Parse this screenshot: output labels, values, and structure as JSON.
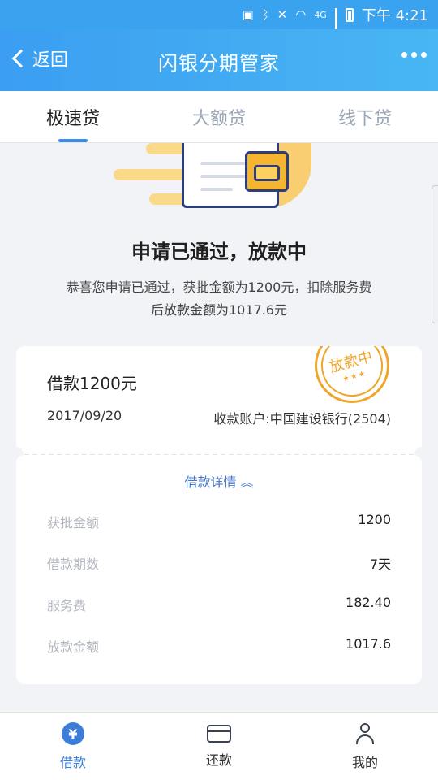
{
  "status_bar": {
    "network": "4G",
    "time": "下午 4:21"
  },
  "header": {
    "back_label": "返回",
    "title": "闪银分期管家"
  },
  "tabs": [
    {
      "label": "极速贷",
      "active": true
    },
    {
      "label": "大额贷",
      "active": false
    },
    {
      "label": "线下贷",
      "active": false
    }
  ],
  "result": {
    "title": "申请已通过，放款中",
    "desc_line1": "恭喜您申请已通过，获批金额为1200元，扣除服务费",
    "desc_line2": "后放款金额为1017.6元"
  },
  "loan_card": {
    "amount": "借款1200元",
    "date": "2017/09/20",
    "account": "收款账户:中国建设银行(2504)",
    "stamp_text": "放款中"
  },
  "details": {
    "toggle_label": "借款详情",
    "rows": [
      {
        "label": "获批金额",
        "value": "1200"
      },
      {
        "label": "借款期数",
        "value": "7天"
      },
      {
        "label": "服务费",
        "value": "182.40"
      },
      {
        "label": "放款金额",
        "value": "1017.6"
      }
    ]
  },
  "bottom_nav": [
    {
      "label": "借款",
      "icon": "yen-icon",
      "active": true
    },
    {
      "label": "还款",
      "icon": "card-icon",
      "active": false
    },
    {
      "label": "我的",
      "icon": "user-icon",
      "active": false
    }
  ],
  "colors": {
    "accent": "#3b7dd8",
    "header_start": "#3b9ef2",
    "header_end": "#48b6f3",
    "stamp": "#f0a52a"
  }
}
